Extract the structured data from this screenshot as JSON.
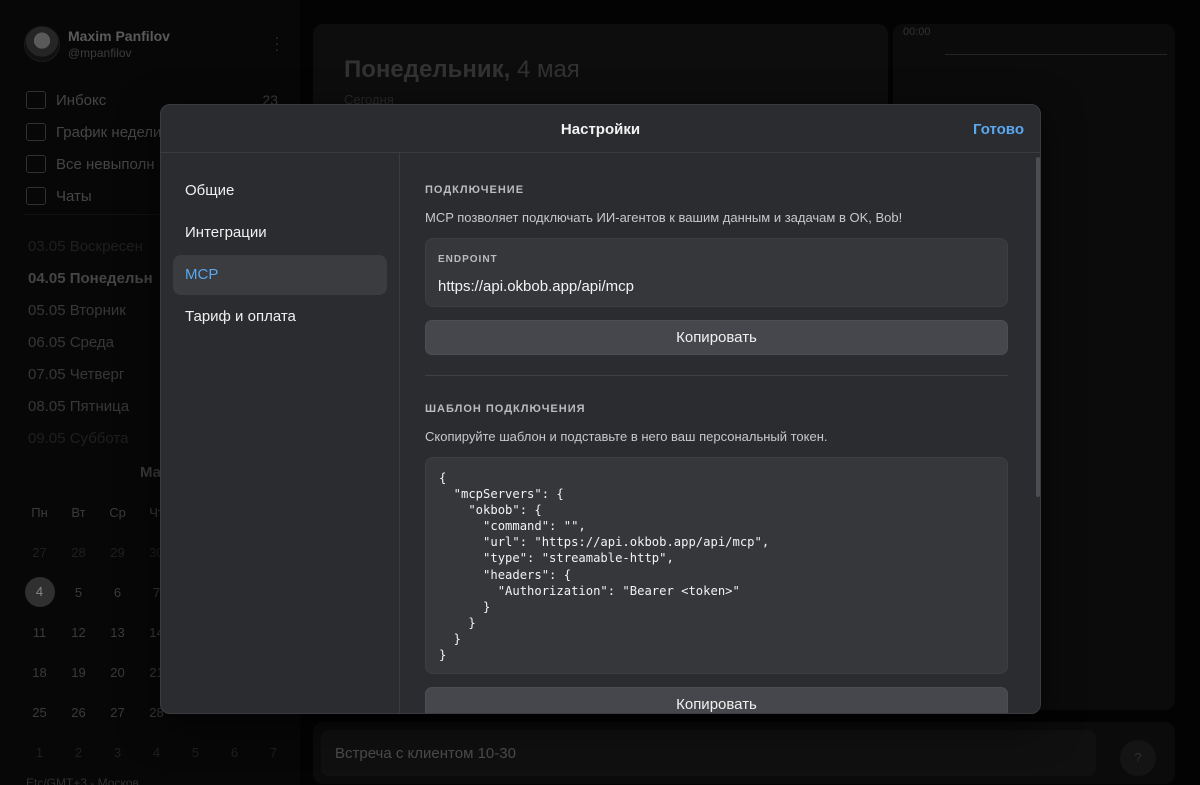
{
  "profile": {
    "name": "Maxim Panfilov",
    "handle": "@mpanfilov"
  },
  "nav": [
    {
      "label": "Инбокс",
      "count": "23"
    },
    {
      "label": "График недели",
      "count": ""
    },
    {
      "label": "Все невыполн",
      "count": ""
    },
    {
      "label": "Чаты",
      "count": ""
    }
  ],
  "days": [
    "03.05 Воскресен",
    "04.05 Понедельн",
    "05.05 Вторник",
    "06.05 Среда",
    "07.05 Четверг",
    "08.05 Пятница",
    "09.05 Суббота"
  ],
  "calendar": {
    "month": "Ма",
    "weekdays": [
      "Пн",
      "Вт",
      "Ср",
      "Чт"
    ],
    "weeks": [
      [
        "27",
        "28",
        "29",
        "30"
      ],
      [
        "4",
        "5",
        "6",
        "7"
      ],
      [
        "11",
        "12",
        "13",
        "14"
      ],
      [
        "18",
        "19",
        "20",
        "21"
      ],
      [
        "25",
        "26",
        "27",
        "28"
      ],
      [
        "1",
        "2",
        "3",
        "4",
        "5",
        "6",
        "7"
      ]
    ]
  },
  "timezone": "Etc/GMT+3 - Москов",
  "main": {
    "title_day": "Понедельник,",
    "title_date": "4 мая",
    "subtitle": "Сегодня"
  },
  "timeline": {
    "first_label": "00:00"
  },
  "bottom": {
    "placeholder": "Встреча с клиентом 10-30",
    "help": "?"
  },
  "modal": {
    "title": "Настройки",
    "done": "Готово",
    "tabs": [
      {
        "label": "Общие",
        "active": false
      },
      {
        "label": "Интеграции",
        "active": false
      },
      {
        "label": "MCP",
        "active": true
      },
      {
        "label": "Тариф и оплата",
        "active": false
      }
    ],
    "connection": {
      "title": "ПОДКЛЮЧЕНИЕ",
      "description": "MCP позволяет подключать ИИ-агентов к вашим данным и задачам в OK, Bob!",
      "endpoint_label": "ENDPOINT",
      "endpoint_value": "https://api.okbob.app/api/mcp",
      "copy": "Копировать"
    },
    "template": {
      "title": "ШАБЛОН ПОДКЛЮЧЕНИЯ",
      "description": "Скопируйте шаблон и подставьте в него ваш персональный токен.",
      "code": "{\n  \"mcpServers\": {\n    \"okbob\": {\n      \"command\": \"\",\n      \"url\": \"https://api.okbob.app/api/mcp\",\n      \"type\": \"streamable-http\",\n      \"headers\": {\n        \"Authorization\": \"Bearer <token>\"\n      }\n    }\n  }\n}",
      "copy": "Копировать"
    }
  },
  "colors": {
    "accent": "#5aa8f0",
    "modal_bg": "#2a2c2f",
    "app_bg": "#050505"
  }
}
